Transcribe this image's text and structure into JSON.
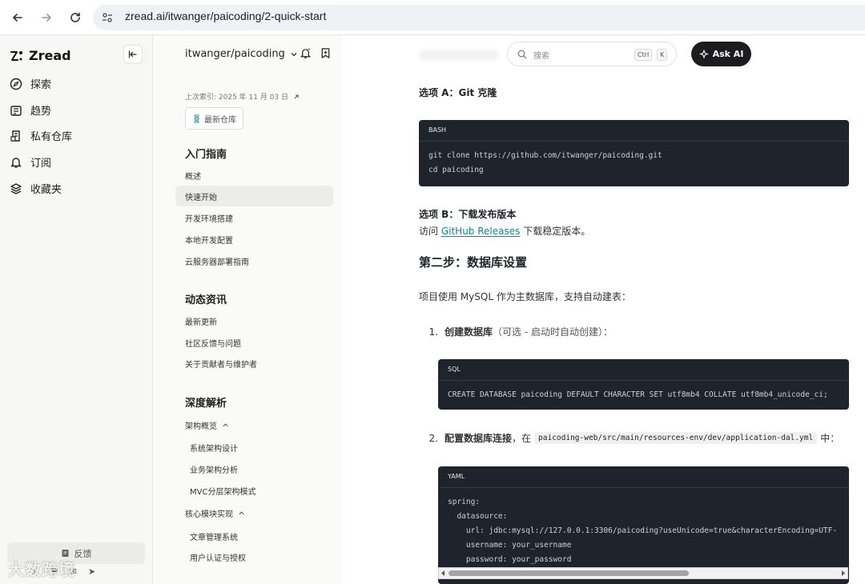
{
  "browser": {
    "url": "zread.ai/itwanger/paicoding/2-quick-start"
  },
  "app": {
    "name": "Zread",
    "nav": [
      {
        "label": "探索",
        "icon": "compass-icon"
      },
      {
        "label": "趋势",
        "icon": "trend-icon"
      },
      {
        "label": "私有仓库",
        "icon": "private-repo-icon"
      },
      {
        "label": "订阅",
        "icon": "bell-icon"
      },
      {
        "label": "收藏夹",
        "icon": "layers-icon"
      }
    ],
    "feedback_label": "反馈",
    "social": [
      "𝕏",
      "♥",
      "✉",
      "➤"
    ]
  },
  "repo": {
    "title": "itwanger/paicoding",
    "indexed_text": "上次索引: 2025 年 11 月 03 日",
    "newest_button": "最新仓库"
  },
  "docnav": {
    "sections": [
      {
        "title": "入门指南",
        "items": [
          "概述",
          "快速开始",
          "开发环境搭建",
          "本地开发配置",
          "云服务器部署指南"
        ]
      },
      {
        "title": "动态资讯",
        "items": [
          "最新更新",
          "社区反馈与问题",
          "关于贡献者与维护者"
        ]
      },
      {
        "title": "深度解析"
      }
    ],
    "active_item": "快速开始",
    "groups": [
      {
        "label": "架构概览",
        "children": [
          "系统架构设计",
          "业务架构分析",
          "MVC分层架构模式"
        ]
      },
      {
        "label": "核心模块实现",
        "children": [
          "文章管理系统",
          "用户认证与授权"
        ]
      }
    ]
  },
  "topbar": {
    "search_placeholder": "搜索",
    "kbd_ctrl": "Ctrl",
    "kbd_k": "K",
    "ask_ai": "Ask AI"
  },
  "content": {
    "option_a_title": "选项 A：Git 克隆",
    "bash_block": {
      "lang": "BASH",
      "lines": [
        "git clone https://github.com/itwanger/paicoding.git",
        "cd paicoding"
      ]
    },
    "option_b_title": "选项 B：下载发布版本",
    "option_b_text_pre": "访问",
    "option_b_link": "GitHub Releases",
    "option_b_text_post": "下载稳定版本。",
    "step2_title": "第二步：数据库设置",
    "step2_intro": "项目使用 MySQL 作为主数据库，支持自动建表：",
    "list": [
      {
        "num": "1.",
        "bold": "创建数据库",
        "rest": "（可选 - 启动时自动创建）："
      },
      {
        "num": "2.",
        "bold": "配置数据库连接",
        "rest_pre": "，在",
        "code": "paicoding-web/src/main/resources-env/dev/application-dal.yml",
        "rest_post": "中："
      }
    ],
    "sql_block": {
      "lang": "SQL",
      "lines": [
        "CREATE DATABASE paicoding DEFAULT CHARACTER SET utf8mb4 COLLATE utf8mb4_unicode_ci;"
      ]
    },
    "yaml_block": {
      "lang": "YAML",
      "lines": [
        "spring:",
        "  datasource:",
        "    url: jdbc:mysql://127.0.0.1:3306/paicoding?useUnicode=true&characterEncoding=UTF-",
        "    username: your_username",
        "    password: your_password"
      ]
    }
  },
  "watermark": "大数跨境"
}
